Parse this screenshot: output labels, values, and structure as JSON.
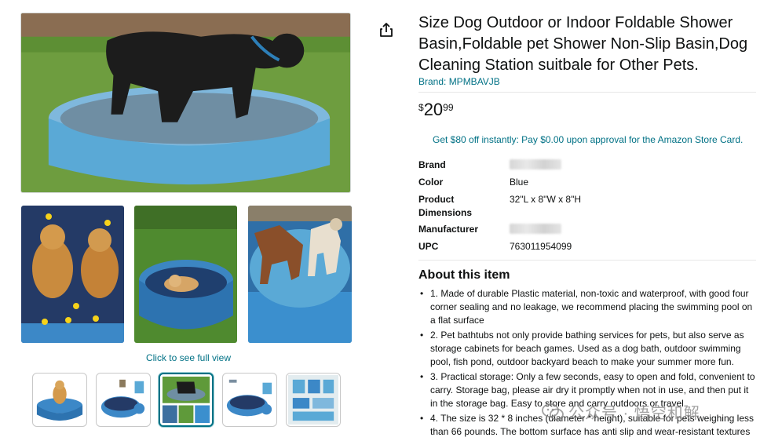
{
  "product": {
    "title": "Size Dog Outdoor or Indoor Foldable Shower Basin,Foldable pet Shower Non-Slip Basin,Dog Cleaning Station suitbale for Other Pets.",
    "brand_link": "Brand: MPMBAVJB",
    "price": {
      "symbol": "$",
      "whole": "20",
      "fraction": "99"
    },
    "promo": "Get $80 off instantly: Pay $0.00 upon approval for the Amazon Store Card."
  },
  "specs": [
    {
      "label": "Brand",
      "value": ""
    },
    {
      "label": "Color",
      "value": "Blue"
    },
    {
      "label": "Product Dimensions",
      "value": "32\"L x 8\"W x 8\"H"
    },
    {
      "label": "Manufacturer",
      "value": ""
    },
    {
      "label": "UPC",
      "value": "763011954099"
    }
  ],
  "about": {
    "title": "About this item",
    "bullet": "•",
    "items": [
      "1. Made of durable Plastic material, non-toxic and waterproof, with good four corner sealing and no leakage, we recommend placing the swimming pool on a flat surface",
      "2. Pet bathtubs not only provide bathing services for pets, but also serve as storage cabinets for beach games. Used as a dog bath, outdoor swimming pool, fish pond, outdoor backyard beach to make your summer more fun.",
      "3. Practical storage: Only a few seconds, easy to open and fold, convenient to carry. Storage bag, please air dry it promptly when not in use, and then put it in the storage bag. Easy to store and carry outdoors or travel.",
      "4. The size is 32 * 8 inches (diameter * height), suitable for pets weighing less than 66 pounds. The bottom surface has anti slip and wear-resistant textures"
    ]
  },
  "gallery": {
    "full_view_link": "Click to see full view",
    "selected_thumbnail": 3
  },
  "watermark": "公众号 · 悟空和解",
  "colors": {
    "link": "#007185",
    "pool_blue": "#5aa9d6",
    "grass": "#5f9a3a"
  }
}
